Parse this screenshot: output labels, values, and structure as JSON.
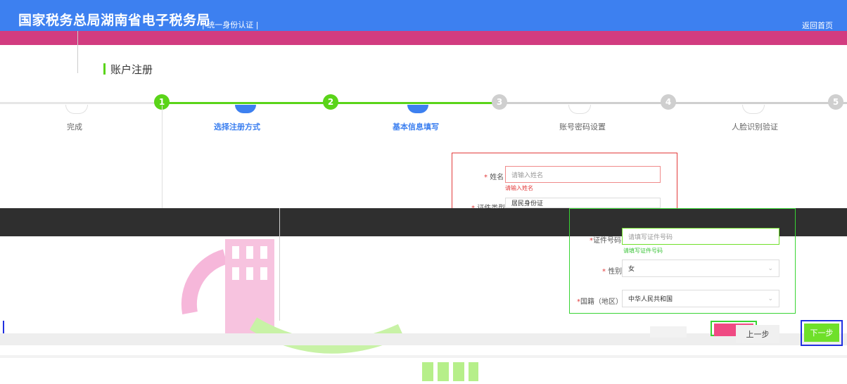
{
  "header": {
    "brand": "国家税务总局湖南省电子税务局",
    "subtitle": "| 统一身份认证 |",
    "home_link": "返回首页"
  },
  "page_title": "账户注册",
  "steps": [
    {
      "number": "1",
      "label": "选择注册方式"
    },
    {
      "number": "2",
      "label": "基本信息填写"
    },
    {
      "number": "3",
      "label": "账号密码设置"
    },
    {
      "number": "4",
      "label": "人脸识别验证"
    },
    {
      "number": "5",
      "label": "完成"
    }
  ],
  "form": {
    "name": {
      "label": "姓名",
      "placeholder": "请输入姓名",
      "error": "请输入姓名"
    },
    "id_type": {
      "label": "证件类型",
      "value": "居民身份证"
    },
    "id_number": {
      "label": "证件号码",
      "placeholder": "请填写证件号码",
      "error": "请填写证件号码"
    },
    "gender": {
      "label": "性别",
      "value": "女"
    },
    "nationality": {
      "label": "国籍（地区）",
      "value": "中华人民共和国"
    }
  },
  "buttons": {
    "prev": "上一步",
    "next": "下一步"
  },
  "colors": {
    "header_blue": "#3d80f0",
    "header_magenta": "#d23c80",
    "accent_green": "#5ad419",
    "step_blue": "#3d80f0",
    "error_red": "#e23b3b"
  }
}
